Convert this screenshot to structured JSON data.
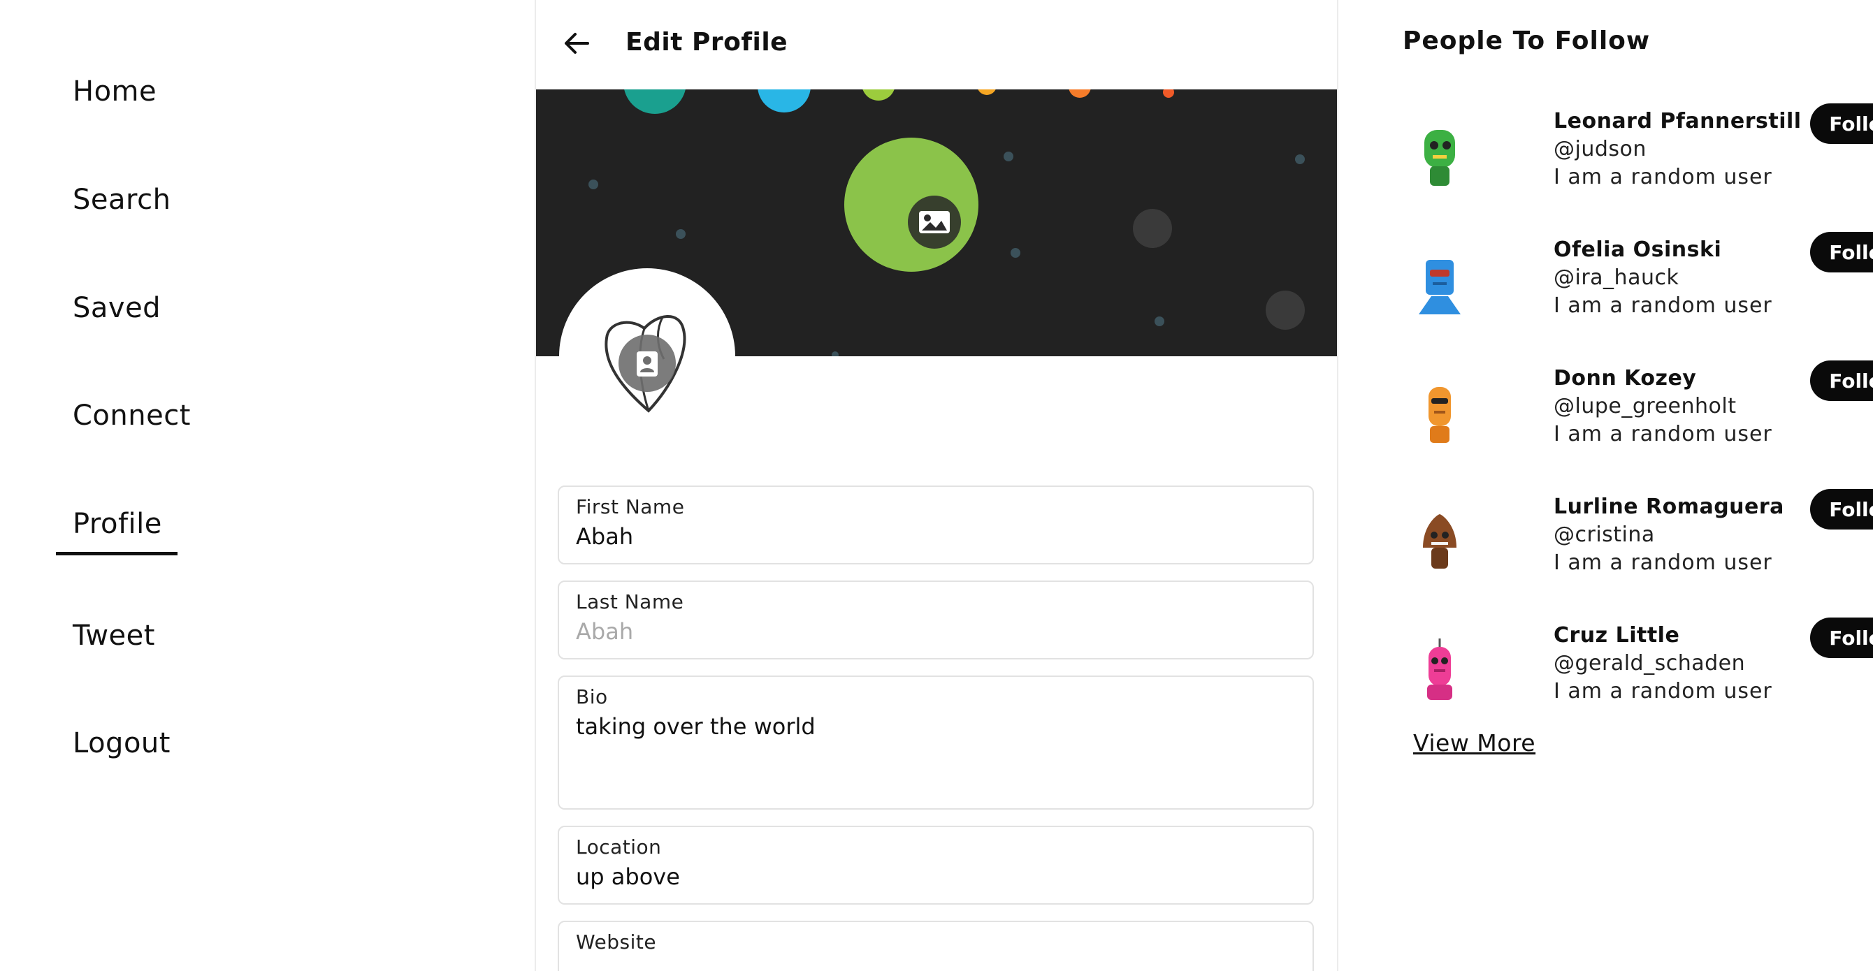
{
  "nav": {
    "items": [
      {
        "label": "Home"
      },
      {
        "label": "Search"
      },
      {
        "label": "Saved"
      },
      {
        "label": "Connect"
      },
      {
        "label": "Profile"
      },
      {
        "label": "Tweet"
      },
      {
        "label": "Logout"
      }
    ],
    "active": "Profile"
  },
  "header": {
    "back_icon": "arrow-left-icon",
    "title": "Edit Profile"
  },
  "banner": {
    "edit_icon": "image-icon",
    "background_color": "#222222",
    "circle_color": "#8bc34a"
  },
  "avatar": {
    "edit_icon": "person-icon"
  },
  "form": {
    "first_name": {
      "label": "First Name",
      "value": "Abah",
      "placeholder": ""
    },
    "last_name": {
      "label": "Last Name",
      "value": "",
      "placeholder": "Abah"
    },
    "bio": {
      "label": "Bio",
      "value": "taking over the world",
      "placeholder": ""
    },
    "location": {
      "label": "Location",
      "value": "up above",
      "placeholder": ""
    },
    "website": {
      "label": "Website",
      "value": "",
      "placeholder": ""
    }
  },
  "people": {
    "title": "People To Follow",
    "follow_label": "Follow",
    "view_more": "View More",
    "users": [
      {
        "name": "Leonard Pfannerstill",
        "handle": "@judson",
        "bio": "I am a random user",
        "color": "#3cb043"
      },
      {
        "name": "Ofelia Osinski",
        "handle": "@ira_hauck",
        "bio": "I am a random user",
        "color": "#2f8fe0"
      },
      {
        "name": "Donn Kozey",
        "handle": "@lupe_greenholt",
        "bio": "I am a random user",
        "color": "#f0962e"
      },
      {
        "name": "Lurline Romaguera",
        "handle": "@cristina",
        "bio": "I am a random user",
        "color": "#8a4b24"
      },
      {
        "name": "Cruz Little",
        "handle": "@gerald_schaden",
        "bio": "I am a random user",
        "color": "#ee3d96"
      }
    ]
  }
}
